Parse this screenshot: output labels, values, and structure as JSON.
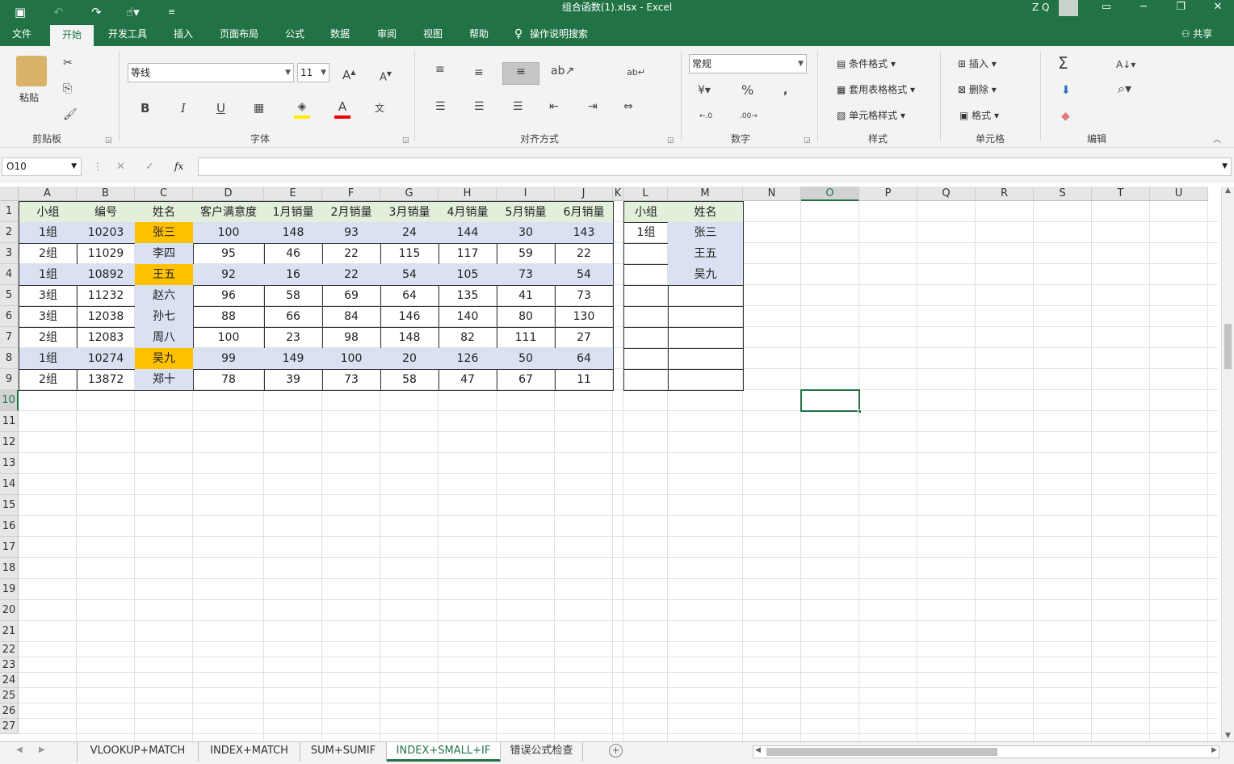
{
  "titlebar": {
    "file_title": "组合函数(1).xlsx  -  Excel",
    "user": "Z Q"
  },
  "ribbon_tabs": [
    "文件",
    "开始",
    "开发工具",
    "插入",
    "页面布局",
    "公式",
    "数据",
    "审阅",
    "视图",
    "帮助",
    "操作说明搜索"
  ],
  "share": "共享",
  "ribbon": {
    "paste": "粘贴",
    "font_name": "等线",
    "font_size": "11",
    "number_format": "常规",
    "cond_format": "条件格式",
    "table_format": "套用表格格式",
    "cell_style": "单元格样式",
    "insert": "插入",
    "delete": "删除",
    "format": "格式",
    "groups": {
      "clipboard": "剪贴板",
      "font": "字体",
      "align": "对齐方式",
      "number": "数字",
      "styles": "样式",
      "cells": "单元格",
      "edit": "编辑"
    }
  },
  "formula_bar": {
    "name_box": "O10",
    "cancel": "✕",
    "enter": "✓",
    "fx": "fx",
    "formula": ""
  },
  "columns": [
    "A",
    "B",
    "C",
    "D",
    "E",
    "F",
    "G",
    "H",
    "I",
    "J",
    "K",
    "L",
    "M",
    "N",
    "O",
    "P",
    "Q",
    "R",
    "S",
    "T",
    "U"
  ],
  "selected_column": "O",
  "rows": [
    "1",
    "2",
    "3",
    "4",
    "5",
    "6",
    "7",
    "8",
    "9",
    "10",
    "11",
    "12",
    "13",
    "14",
    "15",
    "16",
    "17",
    "18",
    "19",
    "20",
    "21",
    "22",
    "23",
    "24",
    "25",
    "26",
    "27"
  ],
  "selected_row": "10",
  "colors": {
    "header_fill": "#e2efda",
    "group1_fill": "#d9e1f2",
    "name_highlight": "#ffc000",
    "accent": "#217346"
  },
  "table": {
    "headers": [
      "小组",
      "编号",
      "姓名",
      "客户满意度",
      "1月销量",
      "2月销量",
      "3月销量",
      "4月销量",
      "5月销量",
      "6月销量"
    ],
    "rows": [
      [
        "1组",
        "10203",
        "张三",
        "100",
        "148",
        "93",
        "24",
        "144",
        "30",
        "143"
      ],
      [
        "2组",
        "11029",
        "李四",
        "95",
        "46",
        "22",
        "115",
        "117",
        "59",
        "22"
      ],
      [
        "1组",
        "10892",
        "王五",
        "92",
        "16",
        "22",
        "54",
        "105",
        "73",
        "54"
      ],
      [
        "3组",
        "11232",
        "赵六",
        "96",
        "58",
        "69",
        "64",
        "135",
        "41",
        "73"
      ],
      [
        "3组",
        "12038",
        "孙七",
        "88",
        "66",
        "84",
        "146",
        "140",
        "80",
        "130"
      ],
      [
        "2组",
        "12083",
        "周八",
        "100",
        "23",
        "98",
        "148",
        "82",
        "111",
        "27"
      ],
      [
        "1组",
        "10274",
        "吴九",
        "99",
        "149",
        "100",
        "20",
        "126",
        "50",
        "64"
      ],
      [
        "2组",
        "13872",
        "郑十",
        "78",
        "39",
        "73",
        "58",
        "47",
        "67",
        "11"
      ]
    ]
  },
  "side_table": {
    "headers": [
      "小组",
      "姓名"
    ],
    "rows": [
      [
        "1组",
        "张三"
      ],
      [
        "",
        "王五"
      ],
      [
        "",
        "吴九"
      ],
      [
        "",
        ""
      ],
      [
        "",
        ""
      ],
      [
        "",
        ""
      ],
      [
        "",
        ""
      ],
      [
        "",
        ""
      ]
    ]
  },
  "sheet_tabs": [
    "VLOOKUP+MATCH",
    "INDEX+MATCH",
    "SUM+SUMIF",
    "INDEX+SMALL+IF",
    "错误公式检查"
  ],
  "active_sheet": "INDEX+SMALL+IF",
  "icons": [
    "save-icon",
    "undo-icon",
    "redo-icon",
    "touch-mode-icon",
    "customize-icon",
    "ribbon-options-icon",
    "minimize-icon",
    "restore-icon",
    "close-icon",
    "lightbulb-icon",
    "share-icon",
    "cut-icon",
    "copy-icon",
    "format-painter-icon",
    "bold-icon",
    "italic-icon",
    "underline-icon",
    "border-icon",
    "fill-color-icon",
    "font-color-icon",
    "phonetic-icon",
    "grow-font-icon",
    "shrink-font-icon",
    "align-top-icon",
    "align-middle-icon",
    "align-bottom-icon",
    "orientation-icon",
    "wrap-text-icon",
    "align-left-icon",
    "align-center-icon",
    "align-right-icon",
    "decrease-indent-icon",
    "increase-indent-icon",
    "merge-icon",
    "currency-icon",
    "percent-icon",
    "comma-icon",
    "sum-icon",
    "fill-icon",
    "clear-icon",
    "sort-filter-icon",
    "find-icon",
    "new-sheet-icon"
  ]
}
